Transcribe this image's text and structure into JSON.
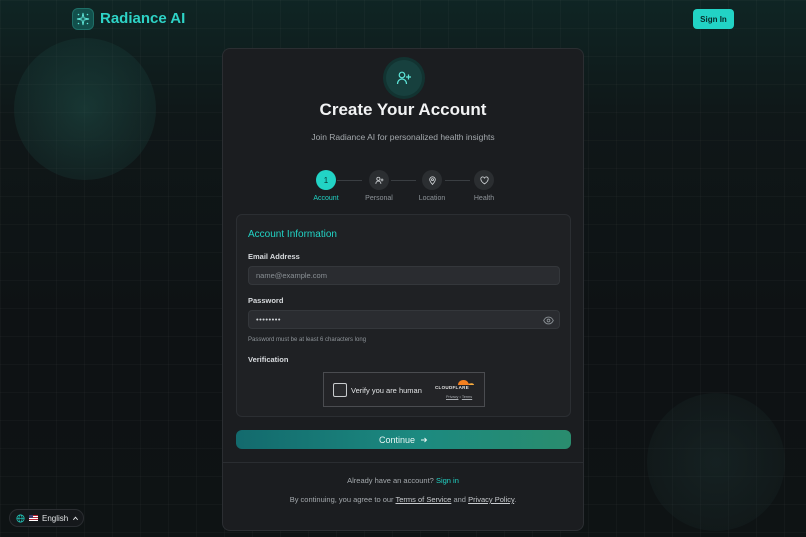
{
  "header": {
    "brand": "Radiance AI",
    "sign_in_label": "Sign In"
  },
  "card": {
    "title": "Create Your Account",
    "subtitle": "Join Radiance AI for personalized health insights",
    "steps": [
      {
        "label": "Account",
        "marker": "1",
        "icon": "number",
        "active": true
      },
      {
        "label": "Personal",
        "icon": "user-plus-icon",
        "active": false
      },
      {
        "label": "Location",
        "icon": "map-pin-icon",
        "active": false
      },
      {
        "label": "Health",
        "icon": "heart-icon",
        "active": false
      }
    ],
    "form": {
      "section_title": "Account Information",
      "email": {
        "label": "Email Address",
        "placeholder": "name@example.com"
      },
      "password": {
        "label": "Password",
        "value": "••••••••",
        "hint": "Password must be at least 6 characters long"
      },
      "verification": {
        "label": "Verification"
      },
      "captcha": {
        "text": "Verify you are human",
        "brand": "CLOUDFLARE",
        "privacy": "Privacy",
        "separator": "•",
        "terms": "Terms"
      }
    },
    "continue_label": "Continue",
    "already_text": "Already have an account?",
    "sign_in_link": "Sign in",
    "agree_prefix": "By continuing, you agree to our",
    "terms_link": "Terms of Service",
    "and_text": "and",
    "privacy_link": "Privacy Policy",
    "period": "."
  },
  "language": {
    "label": "English",
    "flag": "us-flag-icon"
  },
  "colors": {
    "accent": "#22d3c5",
    "card_bg": "#1b1d20",
    "page_bg": "#0e1214"
  }
}
